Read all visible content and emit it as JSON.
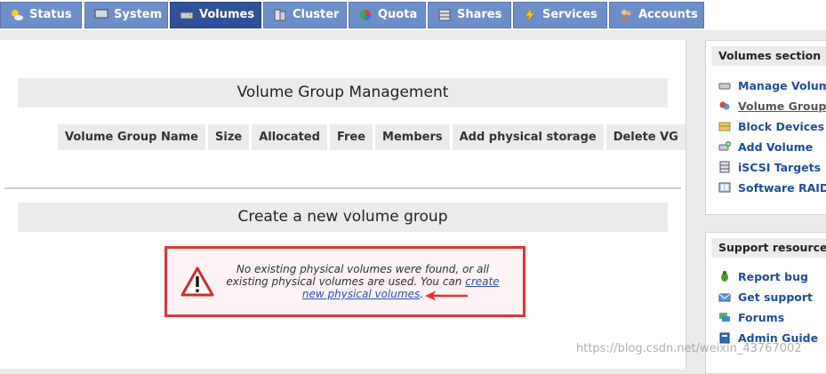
{
  "tabs": [
    {
      "label": "Status",
      "icon": "sun-cloud-icon"
    },
    {
      "label": "System",
      "icon": "monitor-icon"
    },
    {
      "label": "Volumes",
      "icon": "drive-icon",
      "active": true
    },
    {
      "label": "Cluster",
      "icon": "servers-icon"
    },
    {
      "label": "Quota",
      "icon": "pie-chart-icon"
    },
    {
      "label": "Shares",
      "icon": "cabinet-icon"
    },
    {
      "label": "Services",
      "icon": "lightning-icon"
    },
    {
      "label": "Accounts",
      "icon": "users-icon"
    }
  ],
  "main": {
    "vg_title": "Volume Group Management",
    "table_headers": [
      "Volume Group Name",
      "Size",
      "Allocated",
      "Free",
      "Members",
      "Add physical storage",
      "Delete VG"
    ],
    "create_title": "Create a new volume group",
    "warning": {
      "text": "No existing physical volumes were found, or all existing physical volumes are used. You can",
      "link": "create new physical volumes",
      "suffix": "."
    }
  },
  "sidebar": {
    "volumes": {
      "title": "Volumes section",
      "items": [
        {
          "label": "Manage Volumes",
          "icon": "drive-icon"
        },
        {
          "label": "Volume Groups",
          "icon": "volume-group-icon",
          "current": true
        },
        {
          "label": "Block Devices",
          "icon": "block-device-icon"
        },
        {
          "label": "Add Volume",
          "icon": "add-volume-icon"
        },
        {
          "label": "iSCSI Targets",
          "icon": "iscsi-icon"
        },
        {
          "label": "Software RAID",
          "icon": "raid-icon"
        }
      ]
    },
    "support": {
      "title": "Support resources",
      "items": [
        {
          "label": "Report bug",
          "icon": "bug-icon"
        },
        {
          "label": "Get support",
          "icon": "support-icon"
        },
        {
          "label": "Forums",
          "icon": "forum-icon"
        },
        {
          "label": "Admin Guide",
          "icon": "book-icon"
        }
      ]
    }
  },
  "watermark": "https://blog.csdn.net/weixin_43767002",
  "colors": {
    "tab": "#6d8fc9",
    "tab_active": "#2f5199",
    "link": "#1f4e9c",
    "warning_border": "#e53333"
  }
}
